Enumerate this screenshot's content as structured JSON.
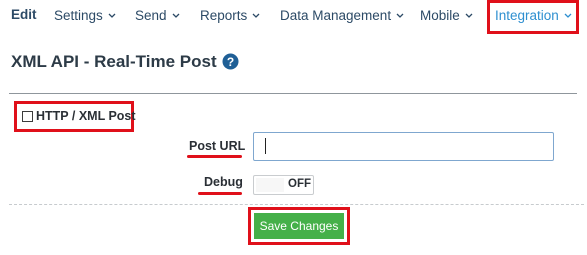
{
  "nav": {
    "items": [
      {
        "label": "Edit",
        "has_chevron": false
      },
      {
        "label": "Settings",
        "has_chevron": true
      },
      {
        "label": "Send",
        "has_chevron": true
      },
      {
        "label": "Reports",
        "has_chevron": true
      },
      {
        "label": "Data Management",
        "has_chevron": true
      },
      {
        "label": "Mobile",
        "has_chevron": true
      },
      {
        "label": "Integration",
        "has_chevron": true,
        "active": true
      }
    ]
  },
  "page": {
    "title": "XML API - Real-Time Post",
    "help_icon": "question-circle-icon"
  },
  "section": {
    "toggle_label": "HTTP / XML Post",
    "checked": false
  },
  "form": {
    "post_url_label": "Post URL",
    "post_url_value": "",
    "debug_label": "Debug",
    "debug_state": "OFF",
    "save_label": "Save Changes"
  },
  "colors": {
    "nav_text": "#2c4a66",
    "nav_active": "#2e8fd0",
    "highlight": "#e0101a",
    "save_button": "#45b049",
    "help_icon": "#1f5f96"
  }
}
